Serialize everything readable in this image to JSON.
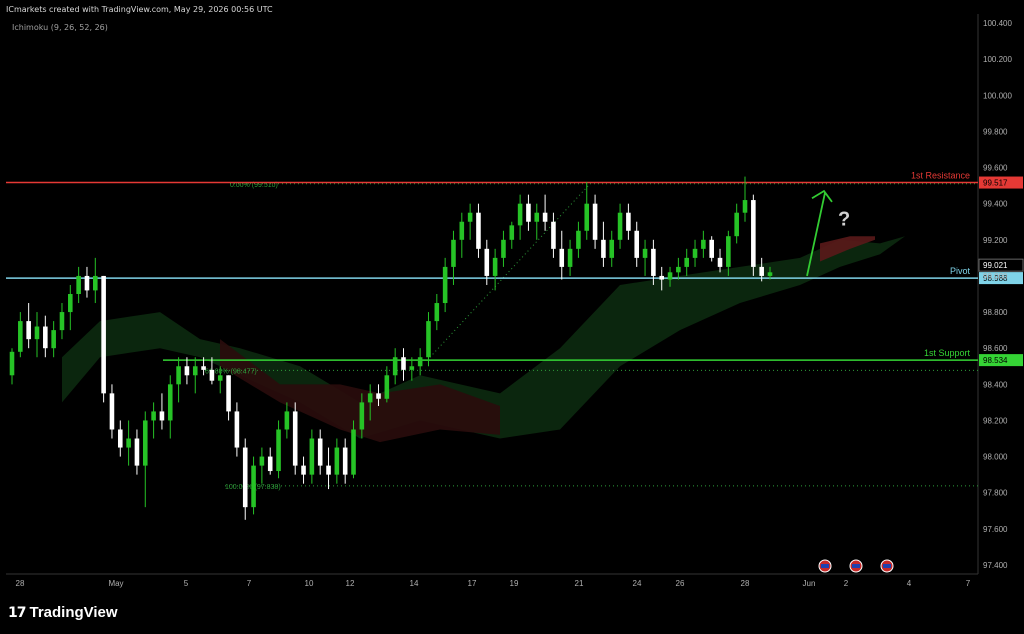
{
  "header": {
    "attribution": "ICmarkets created with TradingView.com, May 29, 2026 00:56 UTC"
  },
  "indicator": {
    "label": "Ichimoku (9, 26, 52, 26)"
  },
  "branding": {
    "logo_text": "TradingView",
    "logo_mark": "17"
  },
  "colors": {
    "bull": "#26c326",
    "bear": "#ffffff",
    "resistance": "#e53935",
    "pivot": "#7fd3e8",
    "support": "#35d435",
    "fib": "#2e9c3a",
    "cloud_green": "#0c2a10",
    "cloud_red": "#2a0c0c",
    "arrow": "#33cc33"
  },
  "chart_data": {
    "type": "candlestick",
    "instrument_note": "Ichimoku (9, 26, 52, 26)",
    "ylim": [
      97.35,
      100.45
    ],
    "y_ticks": [
      "100.400",
      "100.200",
      "100.000",
      "99.800",
      "99.600",
      "99.400",
      "99.200",
      "99.000",
      "98.800",
      "98.600",
      "98.400",
      "98.200",
      "98.000",
      "97.800",
      "97.600",
      "97.400"
    ],
    "x_ticks": [
      "28",
      "May",
      "5",
      "7",
      "10",
      "12",
      "14",
      "17",
      "19",
      "21",
      "24",
      "26",
      "28",
      "Jun",
      "2",
      "4",
      "7"
    ],
    "levels": [
      {
        "name": "1st Resistance",
        "value": 99.517,
        "label": "99.517",
        "color": "resistance"
      },
      {
        "name": "Pivot",
        "value": 98.988,
        "label": "98.988",
        "color": "pivot"
      },
      {
        "name": "1st Support",
        "value": 98.534,
        "label": "98.534",
        "color": "support"
      }
    ],
    "current_price_label": "99.021",
    "fibonacci": [
      {
        "label": "0.00% (99.510)",
        "value": 99.51
      },
      {
        "label": "61.80% (98.477)",
        "value": 98.477
      },
      {
        "label": "100.00% (97.838)",
        "value": 97.838
      }
    ],
    "annotation": "?",
    "candles": [
      [
        98.45,
        98.6,
        98.4,
        98.58
      ],
      [
        98.58,
        98.8,
        98.55,
        98.75
      ],
      [
        98.75,
        98.85,
        98.6,
        98.65
      ],
      [
        98.65,
        98.8,
        98.55,
        98.72
      ],
      [
        98.72,
        98.78,
        98.55,
        98.6
      ],
      [
        98.6,
        98.75,
        98.55,
        98.7
      ],
      [
        98.7,
        98.85,
        98.65,
        98.8
      ],
      [
        98.8,
        98.95,
        98.7,
        98.9
      ],
      [
        98.9,
        99.05,
        98.85,
        99.0
      ],
      [
        99.0,
        99.05,
        98.88,
        98.92
      ],
      [
        98.92,
        99.1,
        98.85,
        99.0
      ],
      [
        99.0,
        99.0,
        98.3,
        98.35
      ],
      [
        98.35,
        98.4,
        98.1,
        98.15
      ],
      [
        98.15,
        98.2,
        98.0,
        98.05
      ],
      [
        98.05,
        98.2,
        97.95,
        98.1
      ],
      [
        98.1,
        98.15,
        97.9,
        97.95
      ],
      [
        97.95,
        98.25,
        97.72,
        98.2
      ],
      [
        98.2,
        98.3,
        98.1,
        98.25
      ],
      [
        98.25,
        98.35,
        98.15,
        98.2
      ],
      [
        98.2,
        98.45,
        98.1,
        98.4
      ],
      [
        98.4,
        98.55,
        98.3,
        98.5
      ],
      [
        98.5,
        98.55,
        98.4,
        98.45
      ],
      [
        98.45,
        98.55,
        98.35,
        98.5
      ],
      [
        98.5,
        98.55,
        98.45,
        98.48
      ],
      [
        98.48,
        98.55,
        98.4,
        98.42
      ],
      [
        98.42,
        98.5,
        98.35,
        98.45
      ],
      [
        98.45,
        98.45,
        98.2,
        98.25
      ],
      [
        98.25,
        98.3,
        98.0,
        98.05
      ],
      [
        98.05,
        98.1,
        97.65,
        97.72
      ],
      [
        97.72,
        98.0,
        97.68,
        97.95
      ],
      [
        97.95,
        98.05,
        97.85,
        98.0
      ],
      [
        98.0,
        98.05,
        97.9,
        97.92
      ],
      [
        97.92,
        98.2,
        97.88,
        98.15
      ],
      [
        98.15,
        98.3,
        98.1,
        98.25
      ],
      [
        98.25,
        98.3,
        97.9,
        97.95
      ],
      [
        97.95,
        98.0,
        97.85,
        97.9
      ],
      [
        97.9,
        98.15,
        97.85,
        98.1
      ],
      [
        98.1,
        98.15,
        97.9,
        97.95
      ],
      [
        97.95,
        98.05,
        97.82,
        97.9
      ],
      [
        97.9,
        98.1,
        97.85,
        98.05
      ],
      [
        98.05,
        98.1,
        97.85,
        97.9
      ],
      [
        97.9,
        98.2,
        97.88,
        98.15
      ],
      [
        98.15,
        98.35,
        98.1,
        98.3
      ],
      [
        98.3,
        98.4,
        98.2,
        98.35
      ],
      [
        98.35,
        98.4,
        98.28,
        98.32
      ],
      [
        98.32,
        98.5,
        98.3,
        98.45
      ],
      [
        98.45,
        98.6,
        98.4,
        98.55
      ],
      [
        98.55,
        98.6,
        98.42,
        98.48
      ],
      [
        98.48,
        98.55,
        98.42,
        98.5
      ],
      [
        98.5,
        98.6,
        98.45,
        98.55
      ],
      [
        98.55,
        98.8,
        98.5,
        98.75
      ],
      [
        98.75,
        98.9,
        98.7,
        98.85
      ],
      [
        98.85,
        99.1,
        98.8,
        99.05
      ],
      [
        99.05,
        99.25,
        98.95,
        99.2
      ],
      [
        99.2,
        99.35,
        99.1,
        99.3
      ],
      [
        99.3,
        99.4,
        99.2,
        99.35
      ],
      [
        99.35,
        99.4,
        99.1,
        99.15
      ],
      [
        99.15,
        99.2,
        98.95,
        99.0
      ],
      [
        99.0,
        99.15,
        98.92,
        99.1
      ],
      [
        99.1,
        99.25,
        99.05,
        99.2
      ],
      [
        99.2,
        99.3,
        99.15,
        99.28
      ],
      [
        99.28,
        99.45,
        99.2,
        99.4
      ],
      [
        99.4,
        99.45,
        99.25,
        99.3
      ],
      [
        99.3,
        99.4,
        99.2,
        99.35
      ],
      [
        99.35,
        99.45,
        99.25,
        99.3
      ],
      [
        99.3,
        99.35,
        99.1,
        99.15
      ],
      [
        99.15,
        99.25,
        98.98,
        99.05
      ],
      [
        99.05,
        99.2,
        99.0,
        99.15
      ],
      [
        99.15,
        99.3,
        99.1,
        99.25
      ],
      [
        99.25,
        99.52,
        99.2,
        99.4
      ],
      [
        99.4,
        99.45,
        99.15,
        99.2
      ],
      [
        99.2,
        99.3,
        99.05,
        99.1
      ],
      [
        99.1,
        99.25,
        99.05,
        99.2
      ],
      [
        99.2,
        99.4,
        99.15,
        99.35
      ],
      [
        99.35,
        99.4,
        99.2,
        99.25
      ],
      [
        99.25,
        99.3,
        99.05,
        99.1
      ],
      [
        99.1,
        99.2,
        99.0,
        99.15
      ],
      [
        99.15,
        99.2,
        98.95,
        99.0
      ],
      [
        99.0,
        99.05,
        98.92,
        98.98
      ],
      [
        98.98,
        99.05,
        98.94,
        99.02
      ],
      [
        99.02,
        99.1,
        98.98,
        99.05
      ],
      [
        99.05,
        99.15,
        99.0,
        99.1
      ],
      [
        99.1,
        99.2,
        99.05,
        99.15
      ],
      [
        99.15,
        99.25,
        99.1,
        99.2
      ],
      [
        99.2,
        99.22,
        99.08,
        99.1
      ],
      [
        99.1,
        99.15,
        99.02,
        99.05
      ],
      [
        99.05,
        99.25,
        99.0,
        99.22
      ],
      [
        99.22,
        99.4,
        99.18,
        99.35
      ],
      [
        99.35,
        99.55,
        99.3,
        99.42
      ],
      [
        99.42,
        99.45,
        99.0,
        99.05
      ],
      [
        99.05,
        99.1,
        98.97,
        99.0
      ],
      [
        99.0,
        99.05,
        98.98,
        99.02
      ]
    ]
  }
}
